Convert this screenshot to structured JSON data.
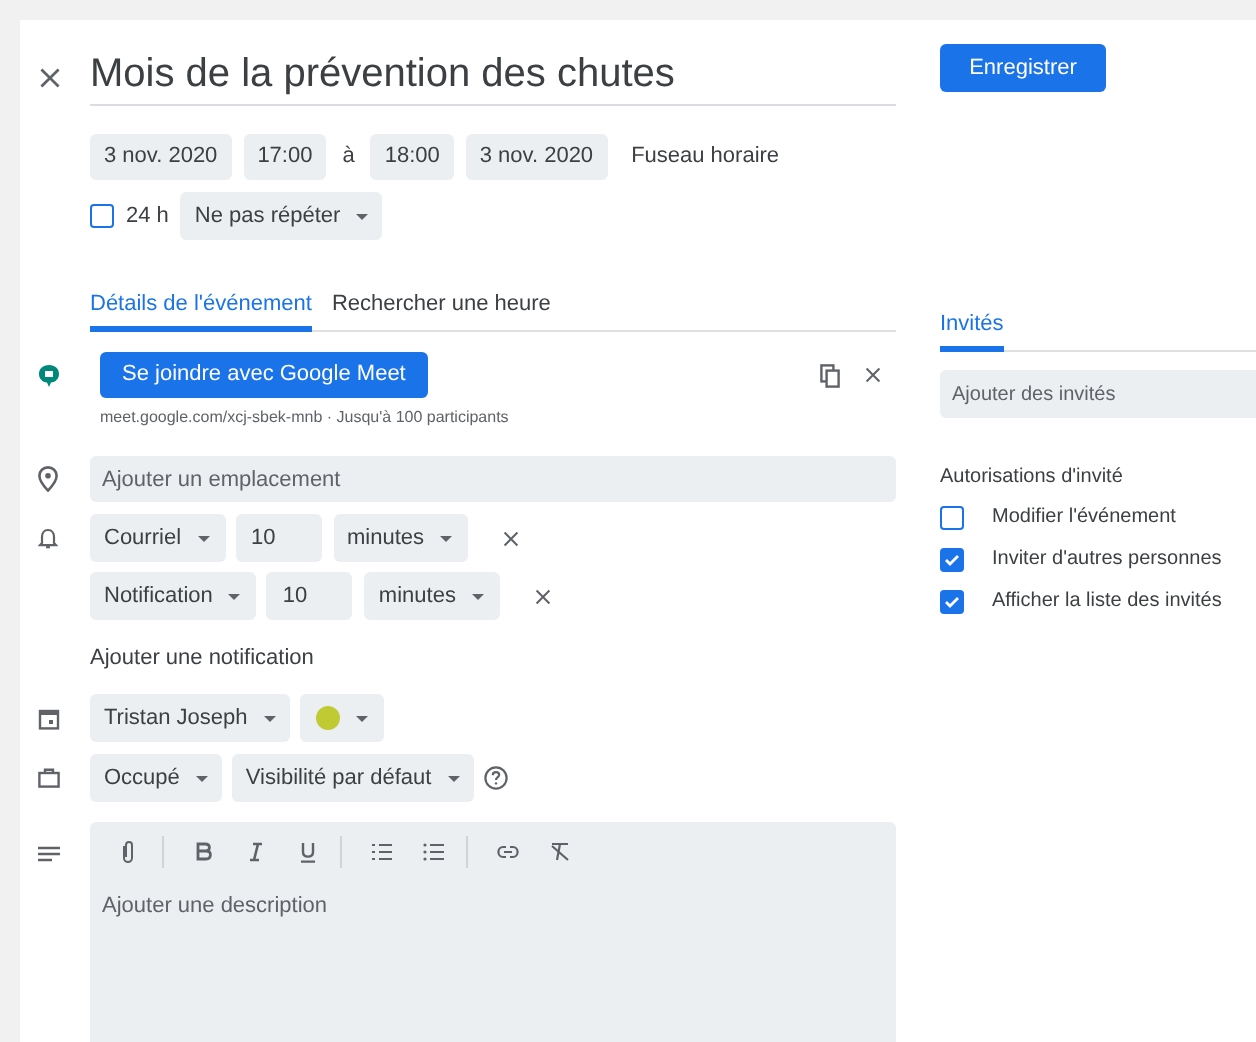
{
  "title": "Mois de la prévention des chutes",
  "save_button": "Enregistrer",
  "date_row": {
    "start_date": "3 nov. 2020",
    "start_time": "17:00",
    "separator": "à",
    "end_time": "18:00",
    "end_date": "3 nov. 2020",
    "timezone": "Fuseau horaire"
  },
  "all_day": {
    "label": "24 h",
    "checked": false
  },
  "repeat": "Ne pas répéter",
  "tabs": [
    {
      "label": "Détails de l'événement",
      "selected": true
    },
    {
      "label": "Rechercher une heure",
      "selected": false
    }
  ],
  "meet": {
    "button": "Se joindre avec Google Meet",
    "info": "meet.google.com/xcj-sbek-mnb · Jusqu'à 100 participants"
  },
  "location": {
    "placeholder": "Ajouter un emplacement"
  },
  "notifications": [
    {
      "type": "Courriel",
      "value": "10",
      "unit": "minutes"
    },
    {
      "type": "Notification",
      "value": "10",
      "unit": "minutes"
    }
  ],
  "add_notification": "Ajouter une notification",
  "calendar": {
    "owner": "Tristan Joseph",
    "color": "#c0ca33"
  },
  "availability": "Occupé",
  "visibility": "Visibilité par défaut",
  "description": {
    "placeholder": "Ajouter une description"
  },
  "guests_tab": {
    "label": "Invités",
    "selected": true
  },
  "guests": {
    "placeholder": "Ajouter des invités"
  },
  "permissions": {
    "title": "Autorisations d'invité",
    "items": [
      {
        "label": "Modifier l'événement",
        "checked": false
      },
      {
        "label": "Inviter d'autres personnes",
        "checked": true
      },
      {
        "label": "Afficher la liste des invités",
        "checked": true
      }
    ]
  }
}
